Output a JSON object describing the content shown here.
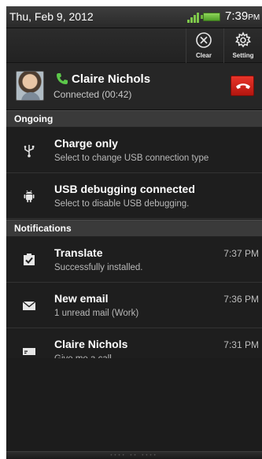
{
  "status_bar": {
    "date": "Thu, Feb 9, 2012",
    "time": "7:39",
    "ampm": "PM",
    "icons": [
      "signal-icon",
      "battery-icon"
    ]
  },
  "quick_actions": {
    "clear_label": "Clear",
    "settings_label": "Setting"
  },
  "call": {
    "name": "Claire Nichols",
    "status": "Connected (00:42)",
    "hangup_color": "#d42a20"
  },
  "sections": {
    "ongoing": "Ongoing",
    "notifications": "Notifications"
  },
  "ongoing": [
    {
      "icon": "usb-icon",
      "title": "Charge only",
      "subtitle": "Select to change USB connection type"
    },
    {
      "icon": "android-debug-icon",
      "title": "USB debugging connected",
      "subtitle": "Select to disable USB debugging."
    }
  ],
  "notifications": [
    {
      "icon": "checkbox-icon",
      "title": "Translate",
      "subtitle": "Successfully installed.",
      "time": "7:37 PM"
    },
    {
      "icon": "mail-icon",
      "title": "New email",
      "subtitle": "1 unread mail (Work)",
      "time": "7:36 PM"
    },
    {
      "icon": "sms-icon",
      "title": "Claire Nichols",
      "subtitle": "Give me a call...",
      "time": "7:31 PM"
    }
  ],
  "colors": {
    "background": "#1c1c1c",
    "section_header": "#3a3a3a",
    "battery": "#6fb03f",
    "call_icon": "#5cc74a"
  }
}
